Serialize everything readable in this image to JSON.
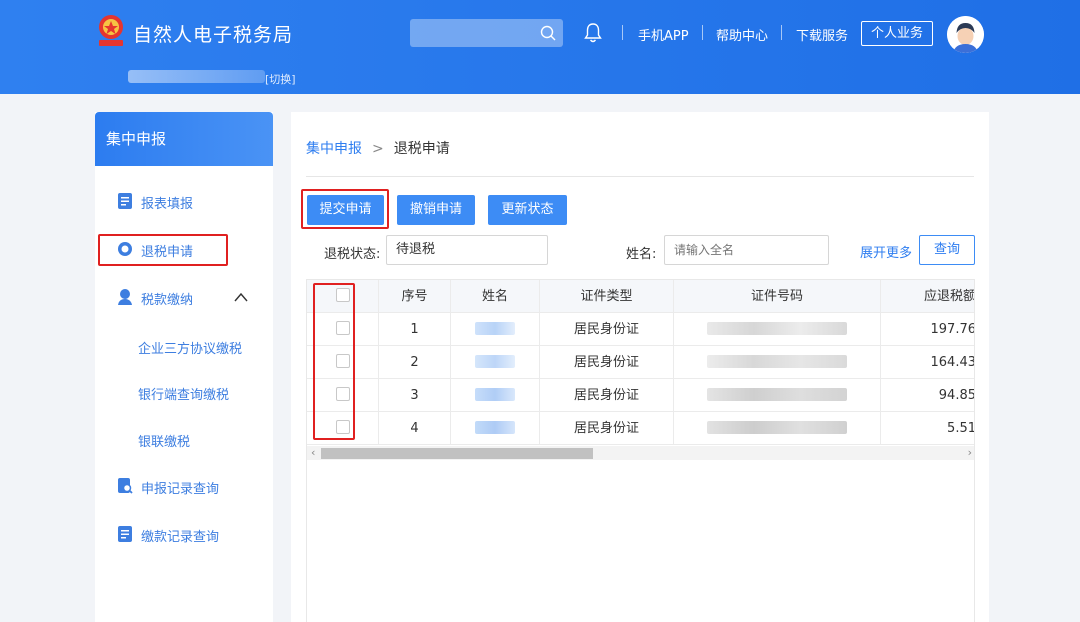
{
  "header": {
    "site_title": "自然人电子税务局",
    "search": {
      "placeholder": ""
    },
    "nav": [
      {
        "label": "手机APP"
      },
      {
        "label": "帮助中心"
      },
      {
        "label": "下载服务"
      }
    ],
    "personal_button": "个人业务",
    "switch_label": "[切换]"
  },
  "sidebar": {
    "title": "集中申报",
    "items": [
      {
        "label": "报表填报",
        "icon": "form-icon"
      },
      {
        "label": "退税申请",
        "icon": "refund-icon"
      },
      {
        "label": "税款缴纳",
        "icon": "tax-payment-icon"
      },
      {
        "label": "申报记录查询",
        "icon": "record-search-icon"
      },
      {
        "label": "缴款记录查询",
        "icon": "payment-record-icon"
      }
    ],
    "sub_items": [
      {
        "label": "企业三方协议缴税"
      },
      {
        "label": "银行端查询缴税"
      },
      {
        "label": "银联缴税"
      }
    ]
  },
  "main": {
    "breadcrumb": {
      "parent": "集中申报",
      "separator": ">",
      "current": "退税申请"
    },
    "buttons": {
      "submit": "提交申请",
      "cancel": "撤销申请",
      "refresh": "更新状态"
    },
    "filters": {
      "status_label": "退税状态:",
      "status_value": "待退税",
      "name_label": "姓名:",
      "name_placeholder": "请输入全名",
      "expand": "展开更多",
      "query": "查询"
    },
    "table": {
      "columns": [
        "序号",
        "姓名",
        "证件类型",
        "证件号码",
        "应退税额"
      ],
      "rows": [
        {
          "index": "1",
          "id_type": "居民身份证",
          "amount": "197.76"
        },
        {
          "index": "2",
          "id_type": "居民身份证",
          "amount": "164.43"
        },
        {
          "index": "3",
          "id_type": "居民身份证",
          "amount": "94.85"
        },
        {
          "index": "4",
          "id_type": "居民身份证",
          "amount": "5.51"
        }
      ]
    }
  },
  "colors": {
    "brand_blue": "#2f80f0",
    "button_blue": "#3d8cf5",
    "highlight_red": "#e02020"
  }
}
